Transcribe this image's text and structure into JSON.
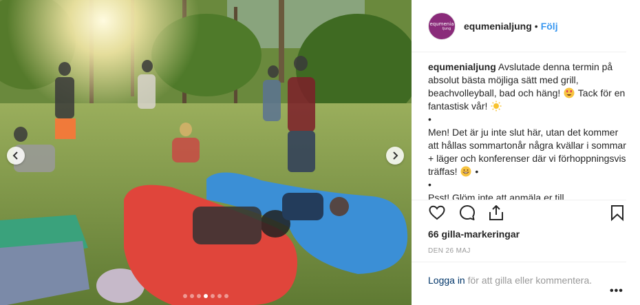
{
  "post": {
    "username": "equmenialjung",
    "separator": "•",
    "follow_label": "Följ",
    "avatar": {
      "line1": "equmenia",
      "line2": "ljung",
      "color": "#8a2b7a"
    },
    "caption": {
      "username": "equmenialjung",
      "line1": "Avslutade denna termin på absolut bästa möjliga sätt med grill, beachvolleyball, bad och häng!",
      "line1b": "Tack för en fantastisk vår!",
      "bullet1": "•",
      "line2": "Men! Det är ju inte slut här, utan det kommer att hållas sommartonår några kvällar i sommar + läger och konferenser där vi förhoppningsvis träffas!",
      "line2_tail": "•",
      "bullet2": "•",
      "line3": "Psst! Glöm inte att anmäla er till"
    },
    "likes": "66 gilla-markeringar",
    "date": "DEN 26 MAJ",
    "login_link": "Logga in",
    "login_text": " för att gilla eller kommentera.",
    "more": "•••",
    "carousel": {
      "count": 7,
      "active_index": 3
    }
  },
  "colors": {
    "link_blue": "#3897f0",
    "text": "#262626",
    "muted": "#999999",
    "login_link": "#003569"
  },
  "icons": {
    "like": "heart-icon",
    "comment": "comment-icon",
    "share": "share-icon",
    "save": "bookmark-icon",
    "prev": "chevron-left-icon",
    "next": "chevron-right-icon"
  }
}
